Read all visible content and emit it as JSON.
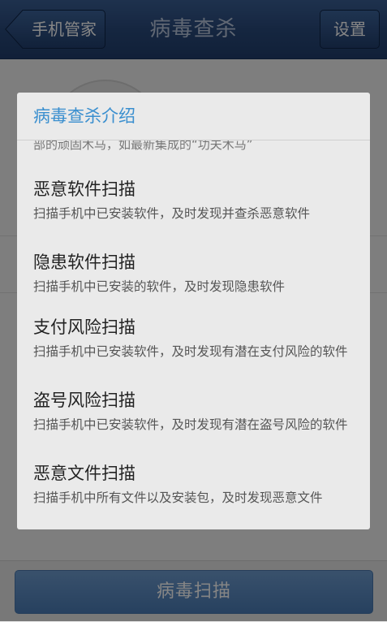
{
  "topbar": {
    "back_label": "手机管家",
    "title": "病毒查杀",
    "settings_label": "设置"
  },
  "background": {
    "scan_button_label": "病毒扫描"
  },
  "dialog": {
    "title": "病毒查杀介绍",
    "partial_line": "部的顽固木马，如最新集成的“功夫木马”",
    "items": [
      {
        "title": "恶意软件扫描",
        "desc": "扫描手机中已安装软件，及时发现并查杀恶意软件"
      },
      {
        "title": "隐患软件扫描",
        "desc": "扫描手机中已安装的软件，及时发现隐患软件"
      },
      {
        "title": "支付风险扫描",
        "desc": "扫描手机中已安装软件，及时发现有潜在支付风险的软件"
      },
      {
        "title": "盗号风险扫描",
        "desc": "扫描手机中已安装软件，及时发现有潜在盗号风险的软件"
      },
      {
        "title": "恶意文件扫描",
        "desc": "扫描手机中所有文件以及安装包，及时发现恶意文件"
      }
    ]
  },
  "colors": {
    "topbar": "#2a4a7c",
    "dialog_title": "#3a8fcf",
    "dialog_bg": "#eaeaea"
  }
}
